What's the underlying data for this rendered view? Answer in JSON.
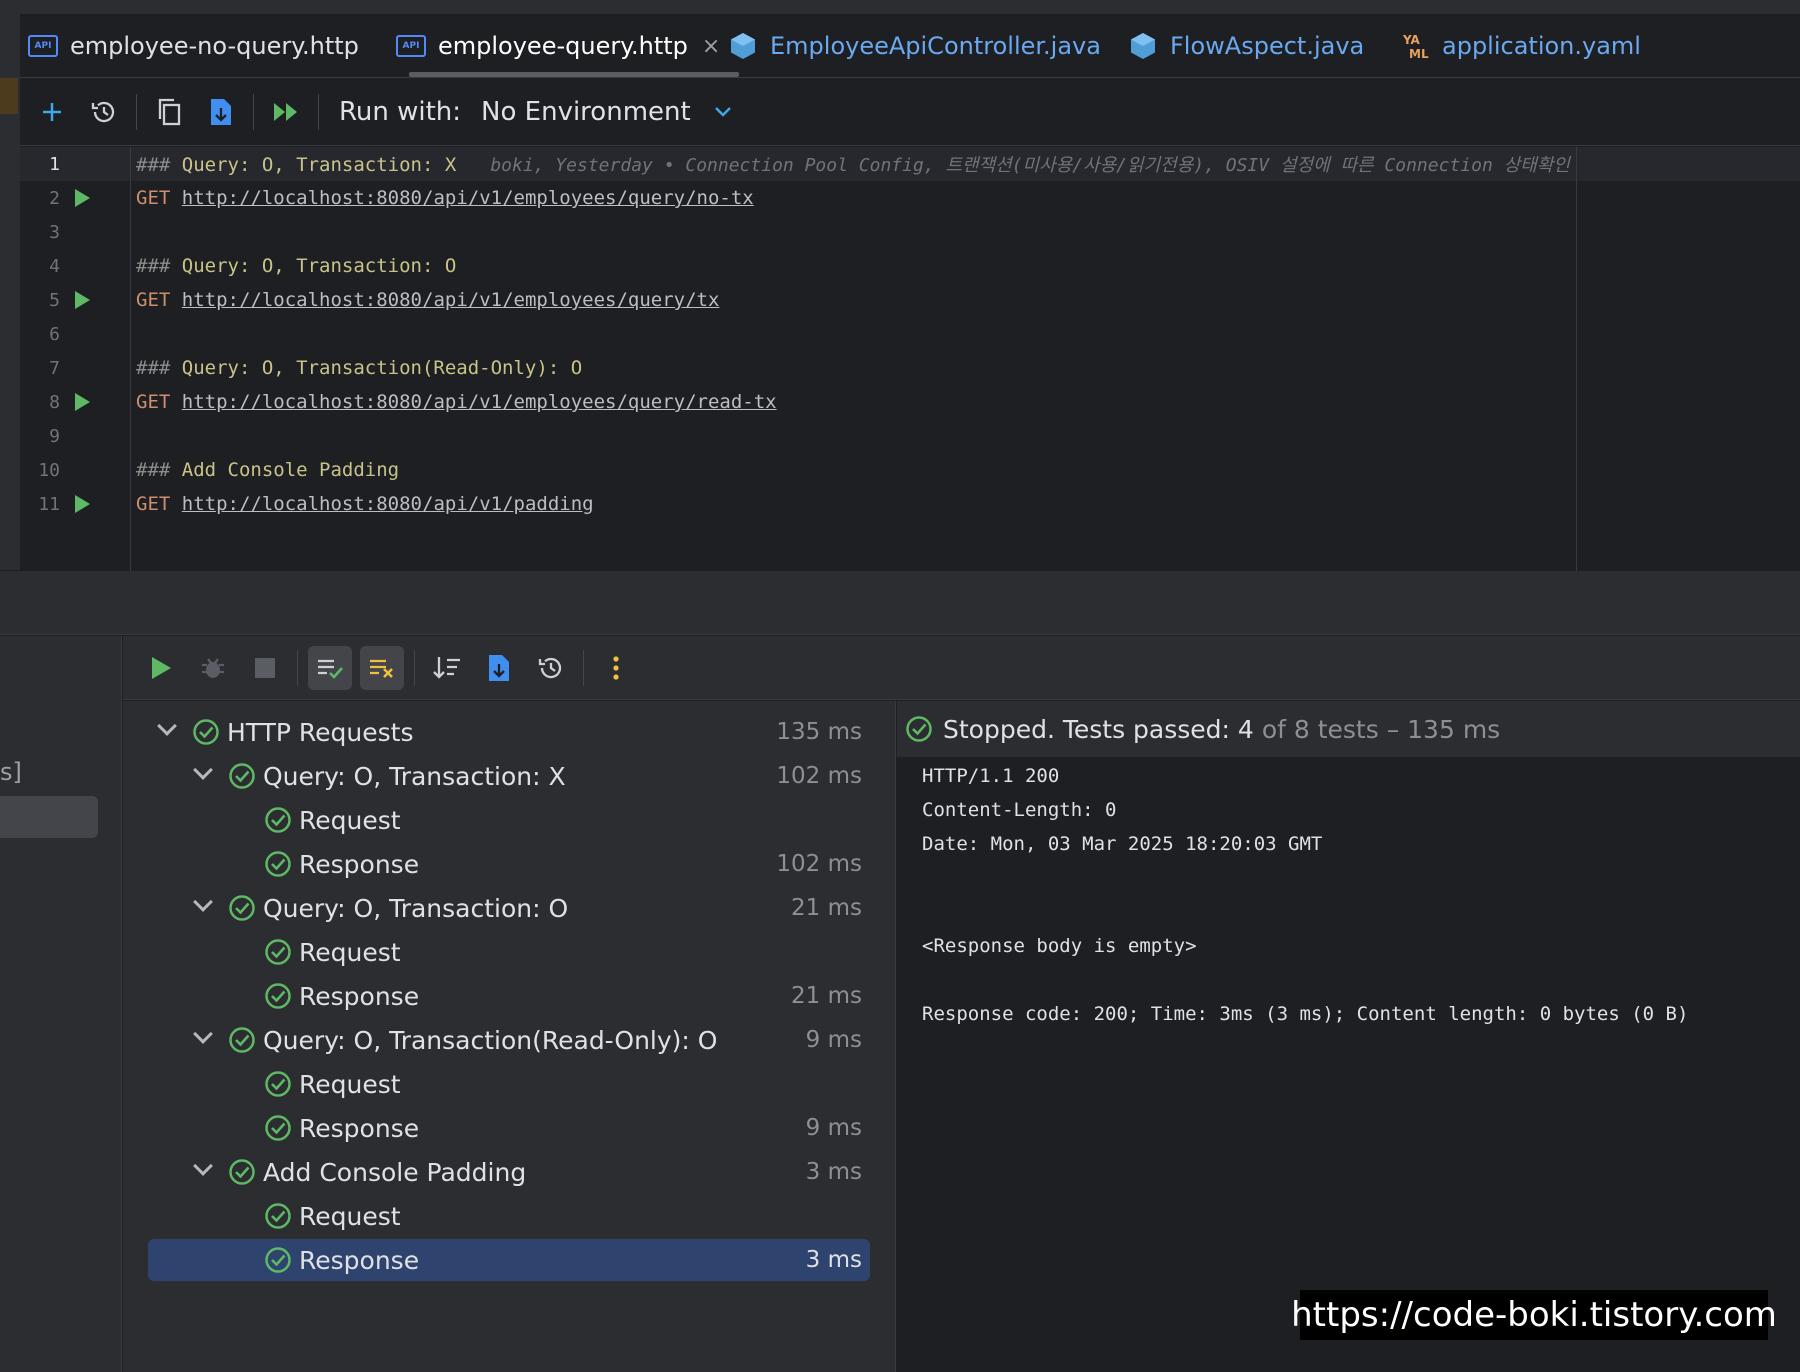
{
  "tabs": [
    {
      "label": "employee-no-query.http",
      "icon": "api-file-icon",
      "active": false
    },
    {
      "label": "employee-query.http",
      "icon": "api-file-icon",
      "active": true,
      "close": "×"
    },
    {
      "label": "EmployeeApiController.java",
      "icon": "java-class-icon",
      "active": false
    },
    {
      "label": "FlowAspect.java",
      "icon": "java-class-icon",
      "active": false
    },
    {
      "label": "application.yaml",
      "icon": "yaml-file-icon",
      "active": false
    }
  ],
  "api_icon_text": "API",
  "yaml_icon_text": "YA\nML",
  "toolbar": {
    "run_with_label": "Run with:",
    "environment": "No Environment",
    "icons": [
      "add-icon",
      "history-icon",
      "copy-icon",
      "export-icon",
      "run-all-icon",
      "chevron-down-icon"
    ]
  },
  "editor": {
    "lines": [
      {
        "n": "1",
        "hash": "###",
        "text": " Query: O, Transaction: X",
        "blame": "boki, Yesterday • Connection Pool Config, 트랜잭션(미사용/사용/읽기전용), OSIV 설정에 따른 Connection 상태확인"
      },
      {
        "n": "2",
        "method": "GET",
        "url": "http://localhost:8080/api/v1/employees/query/no-tx"
      },
      {
        "n": "3"
      },
      {
        "n": "4",
        "hash": "###",
        "text": " Query: O, Transaction: O"
      },
      {
        "n": "5",
        "method": "GET",
        "url": "http://localhost:8080/api/v1/employees/query/tx"
      },
      {
        "n": "6"
      },
      {
        "n": "7",
        "hash": "###",
        "text": " Query: O, Transaction(Read-Only): O"
      },
      {
        "n": "8",
        "method": "GET",
        "url": "http://localhost:8080/api/v1/employees/query/read-tx"
      },
      {
        "n": "9"
      },
      {
        "n": "10",
        "hash": "###",
        "text": " Add Console Padding"
      },
      {
        "n": "11",
        "method": "GET",
        "url": "http://localhost:8080/api/v1/padding"
      }
    ]
  },
  "left_fragment": "s]",
  "run_toolbar_icons": [
    "rerun-icon",
    "debug-icon",
    "stop-icon",
    "show-passed-icon",
    "show-ignored-icon",
    "sort-icon",
    "export-icon",
    "history-icon",
    "more-icon"
  ],
  "tree": [
    {
      "level": 0,
      "label": "HTTP Requests",
      "time": "135 ms",
      "expanded": true
    },
    {
      "level": 1,
      "label": "Query: O, Transaction: X",
      "time": "102 ms",
      "expanded": true
    },
    {
      "level": 2,
      "label": "Request",
      "time": ""
    },
    {
      "level": 2,
      "label": "Response",
      "time": "102 ms"
    },
    {
      "level": 1,
      "label": "Query: O, Transaction: O",
      "time": "21 ms",
      "expanded": true
    },
    {
      "level": 2,
      "label": "Request",
      "time": ""
    },
    {
      "level": 2,
      "label": "Response",
      "time": "21 ms"
    },
    {
      "level": 1,
      "label": "Query: O, Transaction(Read-Only): O",
      "time": "9 ms",
      "expanded": true
    },
    {
      "level": 2,
      "label": "Request",
      "time": ""
    },
    {
      "level": 2,
      "label": "Response",
      "time": "9 ms"
    },
    {
      "level": 1,
      "label": "Add Console Padding",
      "time": "3 ms",
      "expanded": true
    },
    {
      "level": 2,
      "label": "Request",
      "time": ""
    },
    {
      "level": 2,
      "label": "Response",
      "time": "3 ms",
      "selected": true
    }
  ],
  "output": {
    "status_strong": "Stopped. Tests passed: 4",
    "status_dim": "of 8 tests – 135 ms",
    "lines": [
      "HTTP/1.1 200",
      "Content-Length: 0",
      "Date: Mon, 03 Mar 2025 18:20:03 GMT",
      "",
      "",
      "<Response body is empty>",
      "",
      "Response code: 200; Time: 3ms (3 ms); Content length: 0 bytes (0 B)"
    ]
  },
  "watermark": "https://code-boki.tistory.com",
  "colors": {
    "accent_blue": "#548af7",
    "pass_green": "#5fb865",
    "selection": "#2e436e",
    "comment": "#c9c38a",
    "method": "#cf8e6d"
  }
}
